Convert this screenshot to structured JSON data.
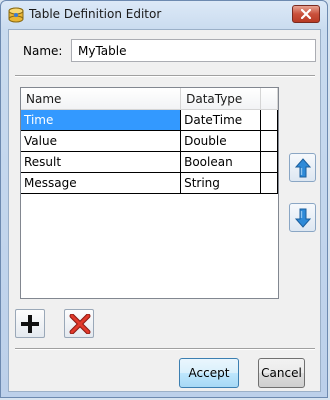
{
  "window": {
    "title": "Table Definition Editor"
  },
  "form": {
    "name_label": "Name:",
    "name_value": "MyTable"
  },
  "grid": {
    "columns": [
      "Name",
      "DataType"
    ],
    "rows": [
      {
        "name": "Time",
        "type": "DateTime",
        "selected": true
      },
      {
        "name": "Value",
        "type": "Double"
      },
      {
        "name": "Result",
        "type": "Boolean"
      },
      {
        "name": "Message",
        "type": "String"
      }
    ]
  },
  "buttons": {
    "accept": "Accept",
    "cancel": "Cancel"
  },
  "icons": {
    "app": "table-definition-icon",
    "close": "close-icon",
    "move_up": "arrow-up-icon",
    "move_down": "arrow-down-icon",
    "add": "plus-icon",
    "delete": "delete-x-icon"
  },
  "colors": {
    "selection": "#3399ff",
    "arrow": "#2e8ad8",
    "delete": "#d62b1e"
  }
}
